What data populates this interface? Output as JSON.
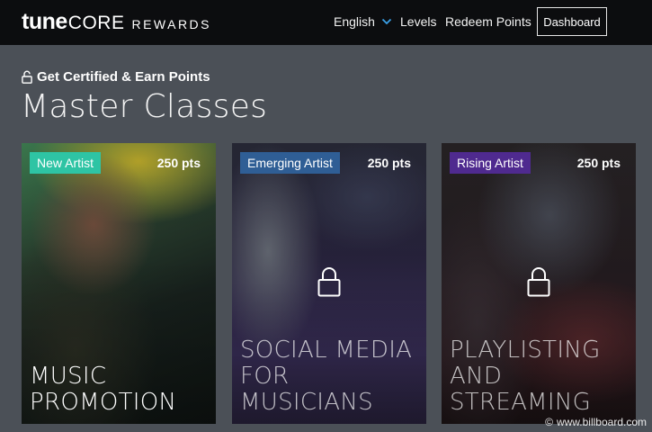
{
  "brand": {
    "tune": "tune",
    "core": "CORE",
    "rewards": "REWARDS"
  },
  "nav": {
    "language": "English",
    "levels": "Levels",
    "redeem": "Redeem Points",
    "dashboard": "Dashboard"
  },
  "header": {
    "eyebrow": "Get Certified & Earn Points",
    "title": "Master Classes"
  },
  "cards": [
    {
      "badge": "New Artist",
      "badge_color": "#2ec4a4",
      "points": "250 pts",
      "title_lines": [
        "MUSIC",
        "PROMOTION"
      ],
      "locked": false
    },
    {
      "badge": "Emerging Artist",
      "badge_color": "#2f5e95",
      "points": "250 pts",
      "title_lines": [
        "SOCIAL MEDIA",
        "FOR",
        "MUSICIANS"
      ],
      "locked": true,
      "icon": "lock-icon"
    },
    {
      "badge": "Rising Artist",
      "badge_color": "#4f2a8f",
      "points": "250 pts",
      "title_lines": [
        "PLAYLISTING",
        "AND",
        "STREAMING"
      ],
      "locked": true,
      "icon": "lock-icon"
    }
  ],
  "watermark": {
    "symbol": "©",
    "text": "www.billboard.com"
  },
  "colors": {
    "navbar": "#0c0d0f",
    "page_bg": "#4b5057"
  }
}
